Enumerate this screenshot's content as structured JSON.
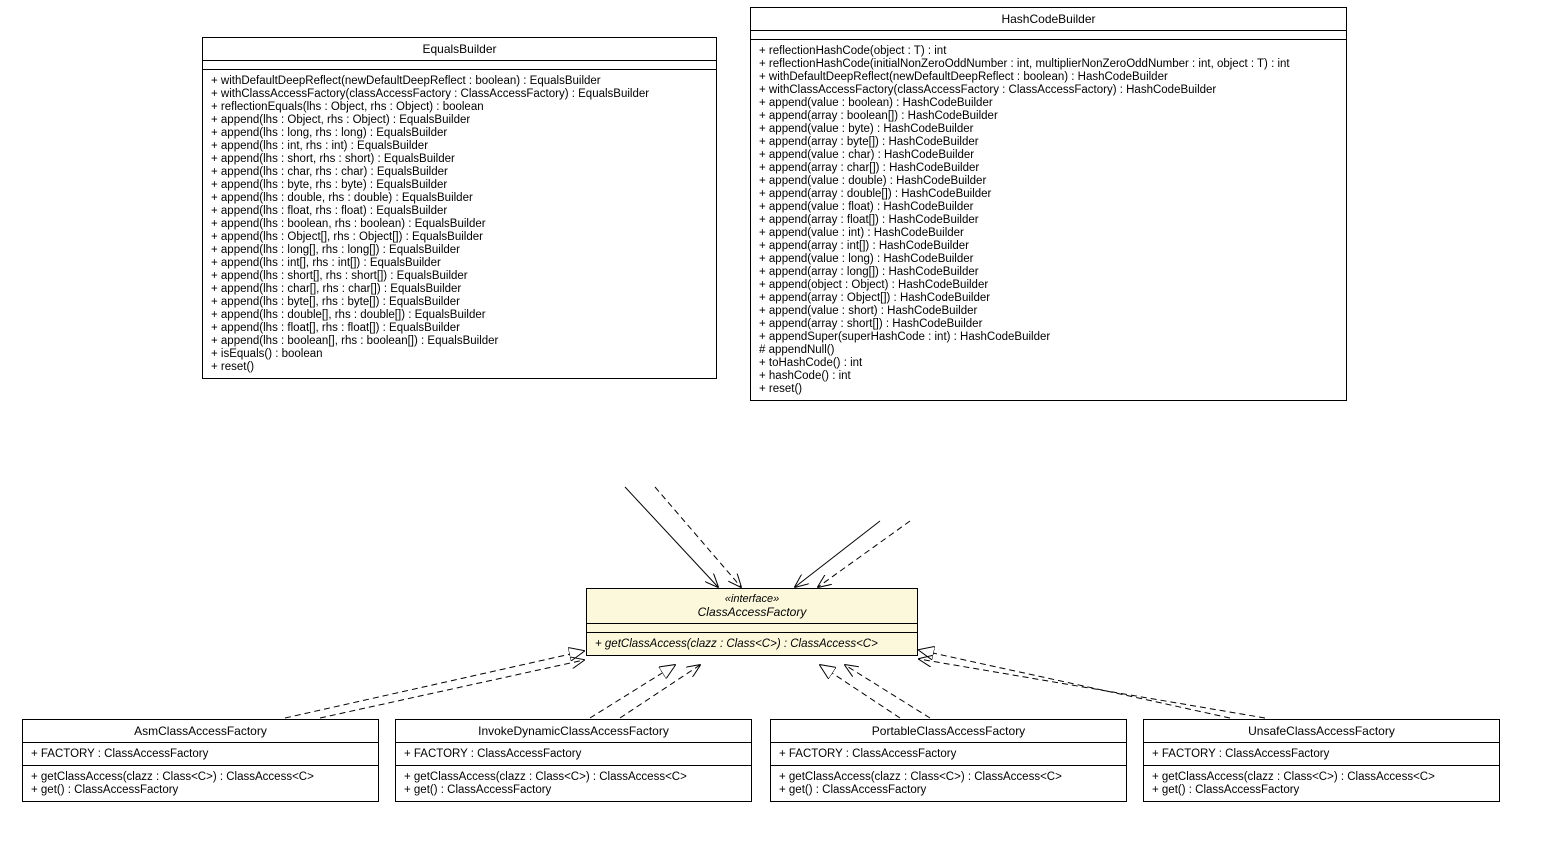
{
  "classes": {
    "equalsBuilder": {
      "name": "EqualsBuilder",
      "methods": [
        "+ withDefaultDeepReflect(newDefaultDeepReflect : boolean) : EqualsBuilder",
        "+ withClassAccessFactory(classAccessFactory : ClassAccessFactory) : EqualsBuilder",
        "+ reflectionEquals(lhs : Object, rhs : Object) : boolean",
        "+ append(lhs : Object, rhs : Object) : EqualsBuilder",
        "+ append(lhs : long, rhs : long) : EqualsBuilder",
        "+ append(lhs : int, rhs : int) : EqualsBuilder",
        "+ append(lhs : short, rhs : short) : EqualsBuilder",
        "+ append(lhs : char, rhs : char) : EqualsBuilder",
        "+ append(lhs : byte, rhs : byte) : EqualsBuilder",
        "+ append(lhs : double, rhs : double) : EqualsBuilder",
        "+ append(lhs : float, rhs : float) : EqualsBuilder",
        "+ append(lhs : boolean, rhs : boolean) : EqualsBuilder",
        "+ append(lhs : Object[], rhs : Object[]) : EqualsBuilder",
        "+ append(lhs : long[], rhs : long[]) : EqualsBuilder",
        "+ append(lhs : int[], rhs : int[]) : EqualsBuilder",
        "+ append(lhs : short[], rhs : short[]) : EqualsBuilder",
        "+ append(lhs : char[], rhs : char[]) : EqualsBuilder",
        "+ append(lhs : byte[], rhs : byte[]) : EqualsBuilder",
        "+ append(lhs : double[], rhs : double[]) : EqualsBuilder",
        "+ append(lhs : float[], rhs : float[]) : EqualsBuilder",
        "+ append(lhs : boolean[], rhs : boolean[]) : EqualsBuilder",
        "+ isEquals() : boolean",
        "+ reset()"
      ]
    },
    "hashCodeBuilder": {
      "name": "HashCodeBuilder",
      "methods": [
        "+ reflectionHashCode(object : T) : int",
        "+ reflectionHashCode(initialNonZeroOddNumber : int, multiplierNonZeroOddNumber : int, object : T) : int",
        "+ withDefaultDeepReflect(newDefaultDeepReflect : boolean) : HashCodeBuilder",
        "+ withClassAccessFactory(classAccessFactory : ClassAccessFactory) : HashCodeBuilder",
        "+ append(value : boolean) : HashCodeBuilder",
        "+ append(array : boolean[]) : HashCodeBuilder",
        "+ append(value : byte) : HashCodeBuilder",
        "+ append(array : byte[]) : HashCodeBuilder",
        "+ append(value : char) : HashCodeBuilder",
        "+ append(array : char[]) : HashCodeBuilder",
        "+ append(value : double) : HashCodeBuilder",
        "+ append(array : double[]) : HashCodeBuilder",
        "+ append(value : float) : HashCodeBuilder",
        "+ append(array : float[]) : HashCodeBuilder",
        "+ append(value : int) : HashCodeBuilder",
        "+ append(array : int[]) : HashCodeBuilder",
        "+ append(value : long) : HashCodeBuilder",
        "+ append(array : long[]) : HashCodeBuilder",
        "+ append(object : Object) : HashCodeBuilder",
        "+ append(array : Object[]) : HashCodeBuilder",
        "+ append(value : short) : HashCodeBuilder",
        "+ append(array : short[]) : HashCodeBuilder",
        "+ appendSuper(superHashCode : int) : HashCodeBuilder",
        "# appendNull()",
        "+ toHashCode() : int",
        "+ hashCode() : int",
        "+ reset()"
      ]
    },
    "classAccessFactory": {
      "stereotype": "«interface»",
      "name": "ClassAccessFactory",
      "methods": [
        "+ getClassAccess(clazz : Class<C>) : ClassAccess<C>"
      ]
    },
    "factory": {
      "fields": [
        "+ FACTORY : ClassAccessFactory"
      ],
      "methods": [
        "+ getClassAccess(clazz : Class<C>) : ClassAccess<C>",
        "+ get() : ClassAccessFactory"
      ]
    },
    "asm": "AsmClassAccessFactory",
    "invoke": "InvokeDynamicClassAccessFactory",
    "portable": "PortableClassAccessFactory",
    "unsafe": "UnsafeClassAccessFactory"
  }
}
